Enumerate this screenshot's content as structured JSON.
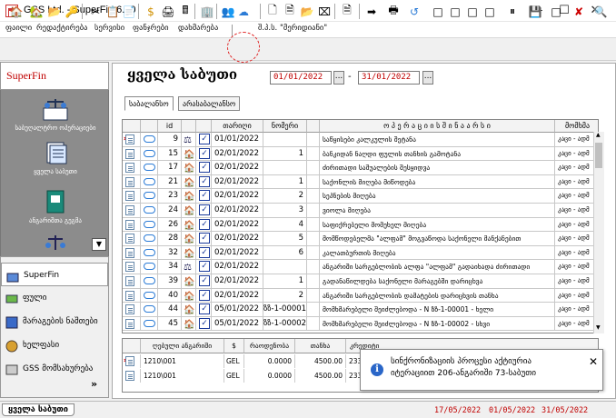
{
  "window": {
    "title": "GSS Ltd. - SuperFin 6.40"
  },
  "menu": [
    "ფაილი",
    "რედაქტირება",
    "სერვისი",
    "ფანჯრები",
    "დახმარება",
    "შ.პ.ს. \"მერიდიანი\""
  ],
  "nav": {
    "header": "SuperFin",
    "tiles": [
      "საბუღალტრო ოპერაციები",
      "ყველა საბუთი",
      "ანგარიშთა გეგმა"
    ],
    "groups": [
      "SuperFin",
      "ფული",
      "მარაგების ნაშთები",
      "ხელფასი",
      "GSS მომსახურება"
    ],
    "more": "»"
  },
  "main": {
    "title": "ყველა საბუთი",
    "date_from": "01/01/2022",
    "date_to": "31/01/2022",
    "dots": "...",
    "date_dash": "-",
    "tabs": [
      "საბალანსო",
      "არასაბალანსო"
    ]
  },
  "table": {
    "headers": [
      "id",
      "თარიღი",
      "ნომერი",
      "ო პ ე რ ა ც ი ი ს   შ ი ნ ა ა რ ს ი",
      "მომხმა"
    ],
    "rows": [
      {
        "star": true,
        "id": "9",
        "date": "01/01/2022",
        "num": "",
        "desc": "საწყისები კალკულის შეტანა",
        "user": "კაცი - ადმ"
      },
      {
        "star": false,
        "id": "15",
        "date": "02/01/2022",
        "num": "1",
        "desc": "ბანკიდან ნაღდი ფულის თანხის გამოტანა",
        "user": "კაცი - ადმ"
      },
      {
        "star": false,
        "id": "17",
        "date": "02/01/2022",
        "num": "",
        "desc": "ძირითადი საშუალების შესყიდვა",
        "user": "კაცი - ადმ"
      },
      {
        "star": false,
        "id": "21",
        "date": "02/01/2022",
        "num": "1",
        "desc": "საქონლის მიღება მიწოდება",
        "user": "კაცი - ადმ"
      },
      {
        "star": false,
        "id": "23",
        "date": "02/01/2022",
        "num": "2",
        "desc": "სეპნების მიღება",
        "user": "კაცი - ადმ"
      },
      {
        "star": false,
        "id": "24",
        "date": "02/01/2022",
        "num": "3",
        "desc": "ვიოლა მიღება",
        "user": "კაცი - ადმ"
      },
      {
        "star": false,
        "id": "26",
        "date": "02/01/2022",
        "num": "4",
        "desc": "საფიქრებელი მომეხელ მიღება",
        "user": "კაცი - ადმ"
      },
      {
        "star": false,
        "id": "28",
        "date": "02/01/2022",
        "num": "5",
        "desc": "მომწოდებელმა \"ალფამ\" მოგვაწოდა საქონელი მანქანებით",
        "user": "კაცი - ადმ"
      },
      {
        "star": false,
        "id": "32",
        "date": "02/01/2022",
        "num": "6",
        "desc": "კალათბურთის მიღება",
        "user": "კაცი - ადმ"
      },
      {
        "star": false,
        "id": "34",
        "date": "02/01/2022",
        "num": "",
        "desc": "ანგარიში სარგებლობის ალფა \"ალფამ\" გადაიხადა ძირითადი",
        "user": "კაცი - ადმ"
      },
      {
        "star": false,
        "id": "39",
        "date": "02/01/2022",
        "num": "1",
        "desc": "გადანაწილდება საქონელი მარაგებში დარიცხვა",
        "user": "კაცი - ადმ"
      },
      {
        "star": false,
        "id": "40",
        "date": "02/01/2022",
        "num": "2",
        "desc": "ანგარიში სარგებლობის დამატების დარიცხვის თანხა",
        "user": "კაცი - ადმ"
      },
      {
        "star": false,
        "id": "44",
        "date": "05/01/2022",
        "num": "ზზ-1-00001",
        "desc": "მომხმარებელი შეიძლებოდა - N ზზ-1-00001 - ხელი",
        "user": "კაცი - ადმ"
      },
      {
        "star": false,
        "id": "45",
        "date": "05/01/2022",
        "num": "ზზ-1-00002",
        "desc": "მომხმარებელი შეიძლებოდა - N ზზ-1-00002 - სხვი",
        "user": "კაცი - ადმ"
      }
    ]
  },
  "lower": {
    "headers": [
      "ღებული ანგარიში",
      "$",
      "რაოდენობა",
      "თანხა",
      "კრედიტი"
    ],
    "rows": [
      {
        "star": true,
        "acct": "1210\\001",
        "cur": "GEL",
        "qty": "0.0000",
        "amt": "4500.00",
        "cr": "2330"
      },
      {
        "star": false,
        "acct": "1210\\001",
        "cur": "GEL",
        "qty": "0.0000",
        "amt": "4500.00",
        "cr": "2330"
      }
    ]
  },
  "toast": {
    "text": "სინქრონიზაციის პროცესი აქტიურია იტერაციით 206-ანგარიში 73-საბუთი",
    "icon": "info-icon",
    "close": "✕"
  },
  "status": {
    "tab": "ყველა საბუთი",
    "dates": [
      "17/05/2022",
      "01/05/2022",
      "31/05/2022"
    ]
  },
  "colors": {
    "accent_red": "#c00000",
    "nav_panel": "#8c8c8c",
    "check_blue": "#1a3a9a",
    "cloud_blue": "#2b7bd6"
  }
}
